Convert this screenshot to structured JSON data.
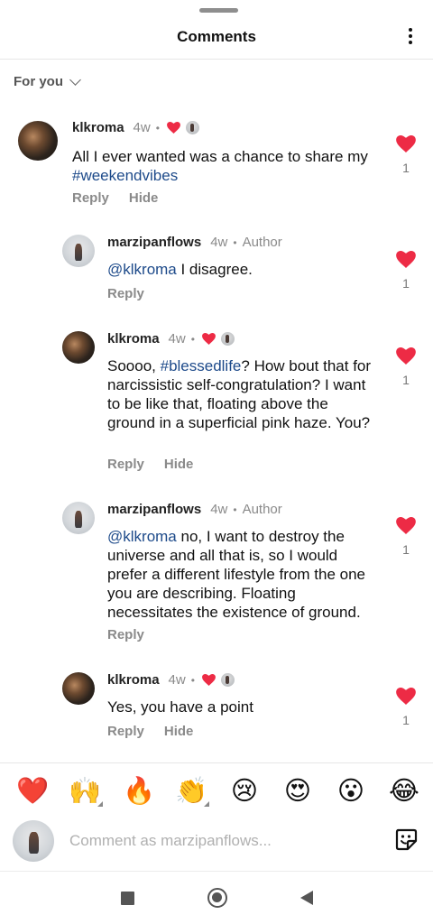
{
  "header": {
    "title": "Comments"
  },
  "filter": {
    "label": "For you"
  },
  "comments": [
    {
      "username": "klkroma",
      "age": "4w",
      "text_plain": "All I ever wanted was a chance to share my ",
      "link": "#weekendvibes",
      "text_after": "",
      "reply": "Reply",
      "hide": "Hide",
      "likes": "1"
    },
    {
      "username": "marzipanflows",
      "age": "4w",
      "author": "Author",
      "mention": "@klkroma",
      "text_plain": " I disagree.",
      "reply": "Reply",
      "likes": "1"
    },
    {
      "username": "klkroma",
      "age": "4w",
      "text_plain": "Soooo, ",
      "link": "#blessedlife",
      "text_after": "? How bout that for narcissistic self-congratulation? I want to be like that, floating above the ground in a superficial pink haze. You?",
      "reply": "Reply",
      "hide": "Hide",
      "likes": "1"
    },
    {
      "username": "marzipanflows",
      "age": "4w",
      "author": "Author",
      "mention": "@klkroma",
      "text_plain": " no, I want to destroy the universe and all that is, so I would prefer a different lifestyle from the one you are describing. Floating necessitates the existence of ground.",
      "reply": "Reply",
      "likes": "1"
    },
    {
      "username": "klkroma",
      "age": "4w",
      "text_plain": "Yes, you have a point",
      "reply": "Reply",
      "hide": "Hide",
      "likes": "1"
    }
  ],
  "reactions": [
    "❤️",
    "🙌",
    "🔥",
    "👏",
    "😢",
    "😍",
    "😮",
    "😂"
  ],
  "composer": {
    "placeholder": "Comment as marzipanflows..."
  },
  "colors": {
    "heart": "#ed2b45",
    "link": "#1d4a8a",
    "muted": "#8a8a8a"
  },
  "icons": {
    "more": "more-vertical-icon",
    "sticker": "sticker-icon",
    "heart": "heart-icon"
  }
}
